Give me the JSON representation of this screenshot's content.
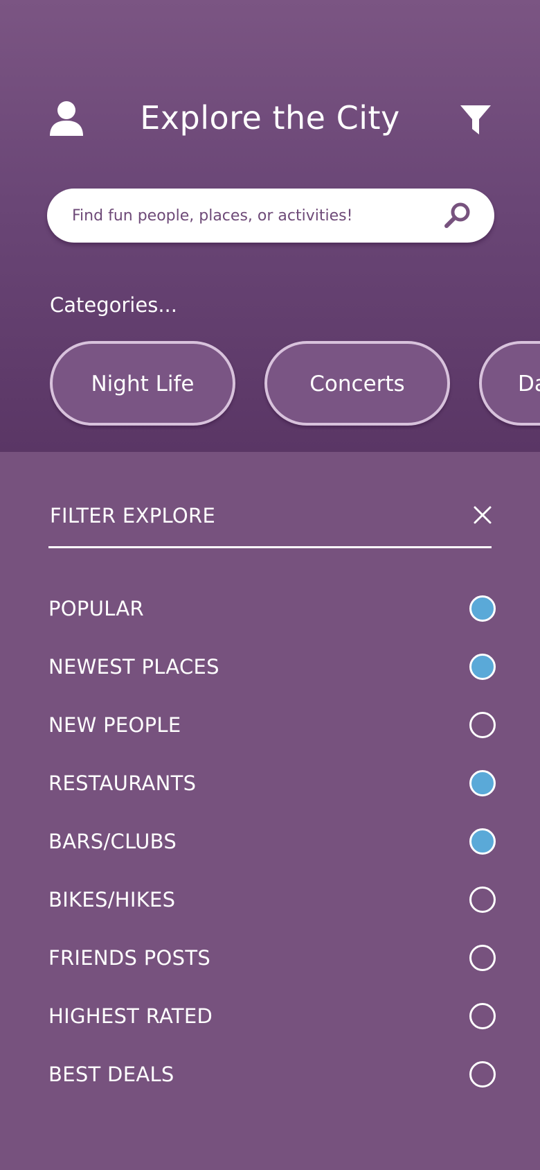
{
  "header": {
    "title": "Explore the City",
    "profile_icon": "user-icon",
    "filter_icon": "funnel-icon"
  },
  "search": {
    "placeholder": "Find fun people, places, or activities!",
    "value": "",
    "icon": "search-icon"
  },
  "categories": {
    "label": "Categories...",
    "items": [
      {
        "label": "Night Life"
      },
      {
        "label": "Concerts"
      },
      {
        "label": "Da"
      }
    ]
  },
  "filter": {
    "title": "FILTER EXPLORE",
    "close_icon": "close-icon",
    "options": [
      {
        "label": "POPULAR",
        "selected": true
      },
      {
        "label": "NEWEST PLACES",
        "selected": true
      },
      {
        "label": "NEW PEOPLE",
        "selected": false
      },
      {
        "label": "RESTAURANTS",
        "selected": true
      },
      {
        "label": "BARS/CLUBS",
        "selected": true
      },
      {
        "label": "BIKES/HIKES",
        "selected": false
      },
      {
        "label": "FRIENDS POSTS",
        "selected": false
      },
      {
        "label": "HIGHEST RATED",
        "selected": false
      },
      {
        "label": "BEST DEALS",
        "selected": false
      }
    ]
  },
  "colors": {
    "background": "#77527e",
    "header_gradient_end": "#5a3665",
    "pill_border": "#d8c2dc",
    "selected_radio": "#5aa9d8",
    "text": "#ffffff",
    "search_text": "#6e4a78"
  }
}
